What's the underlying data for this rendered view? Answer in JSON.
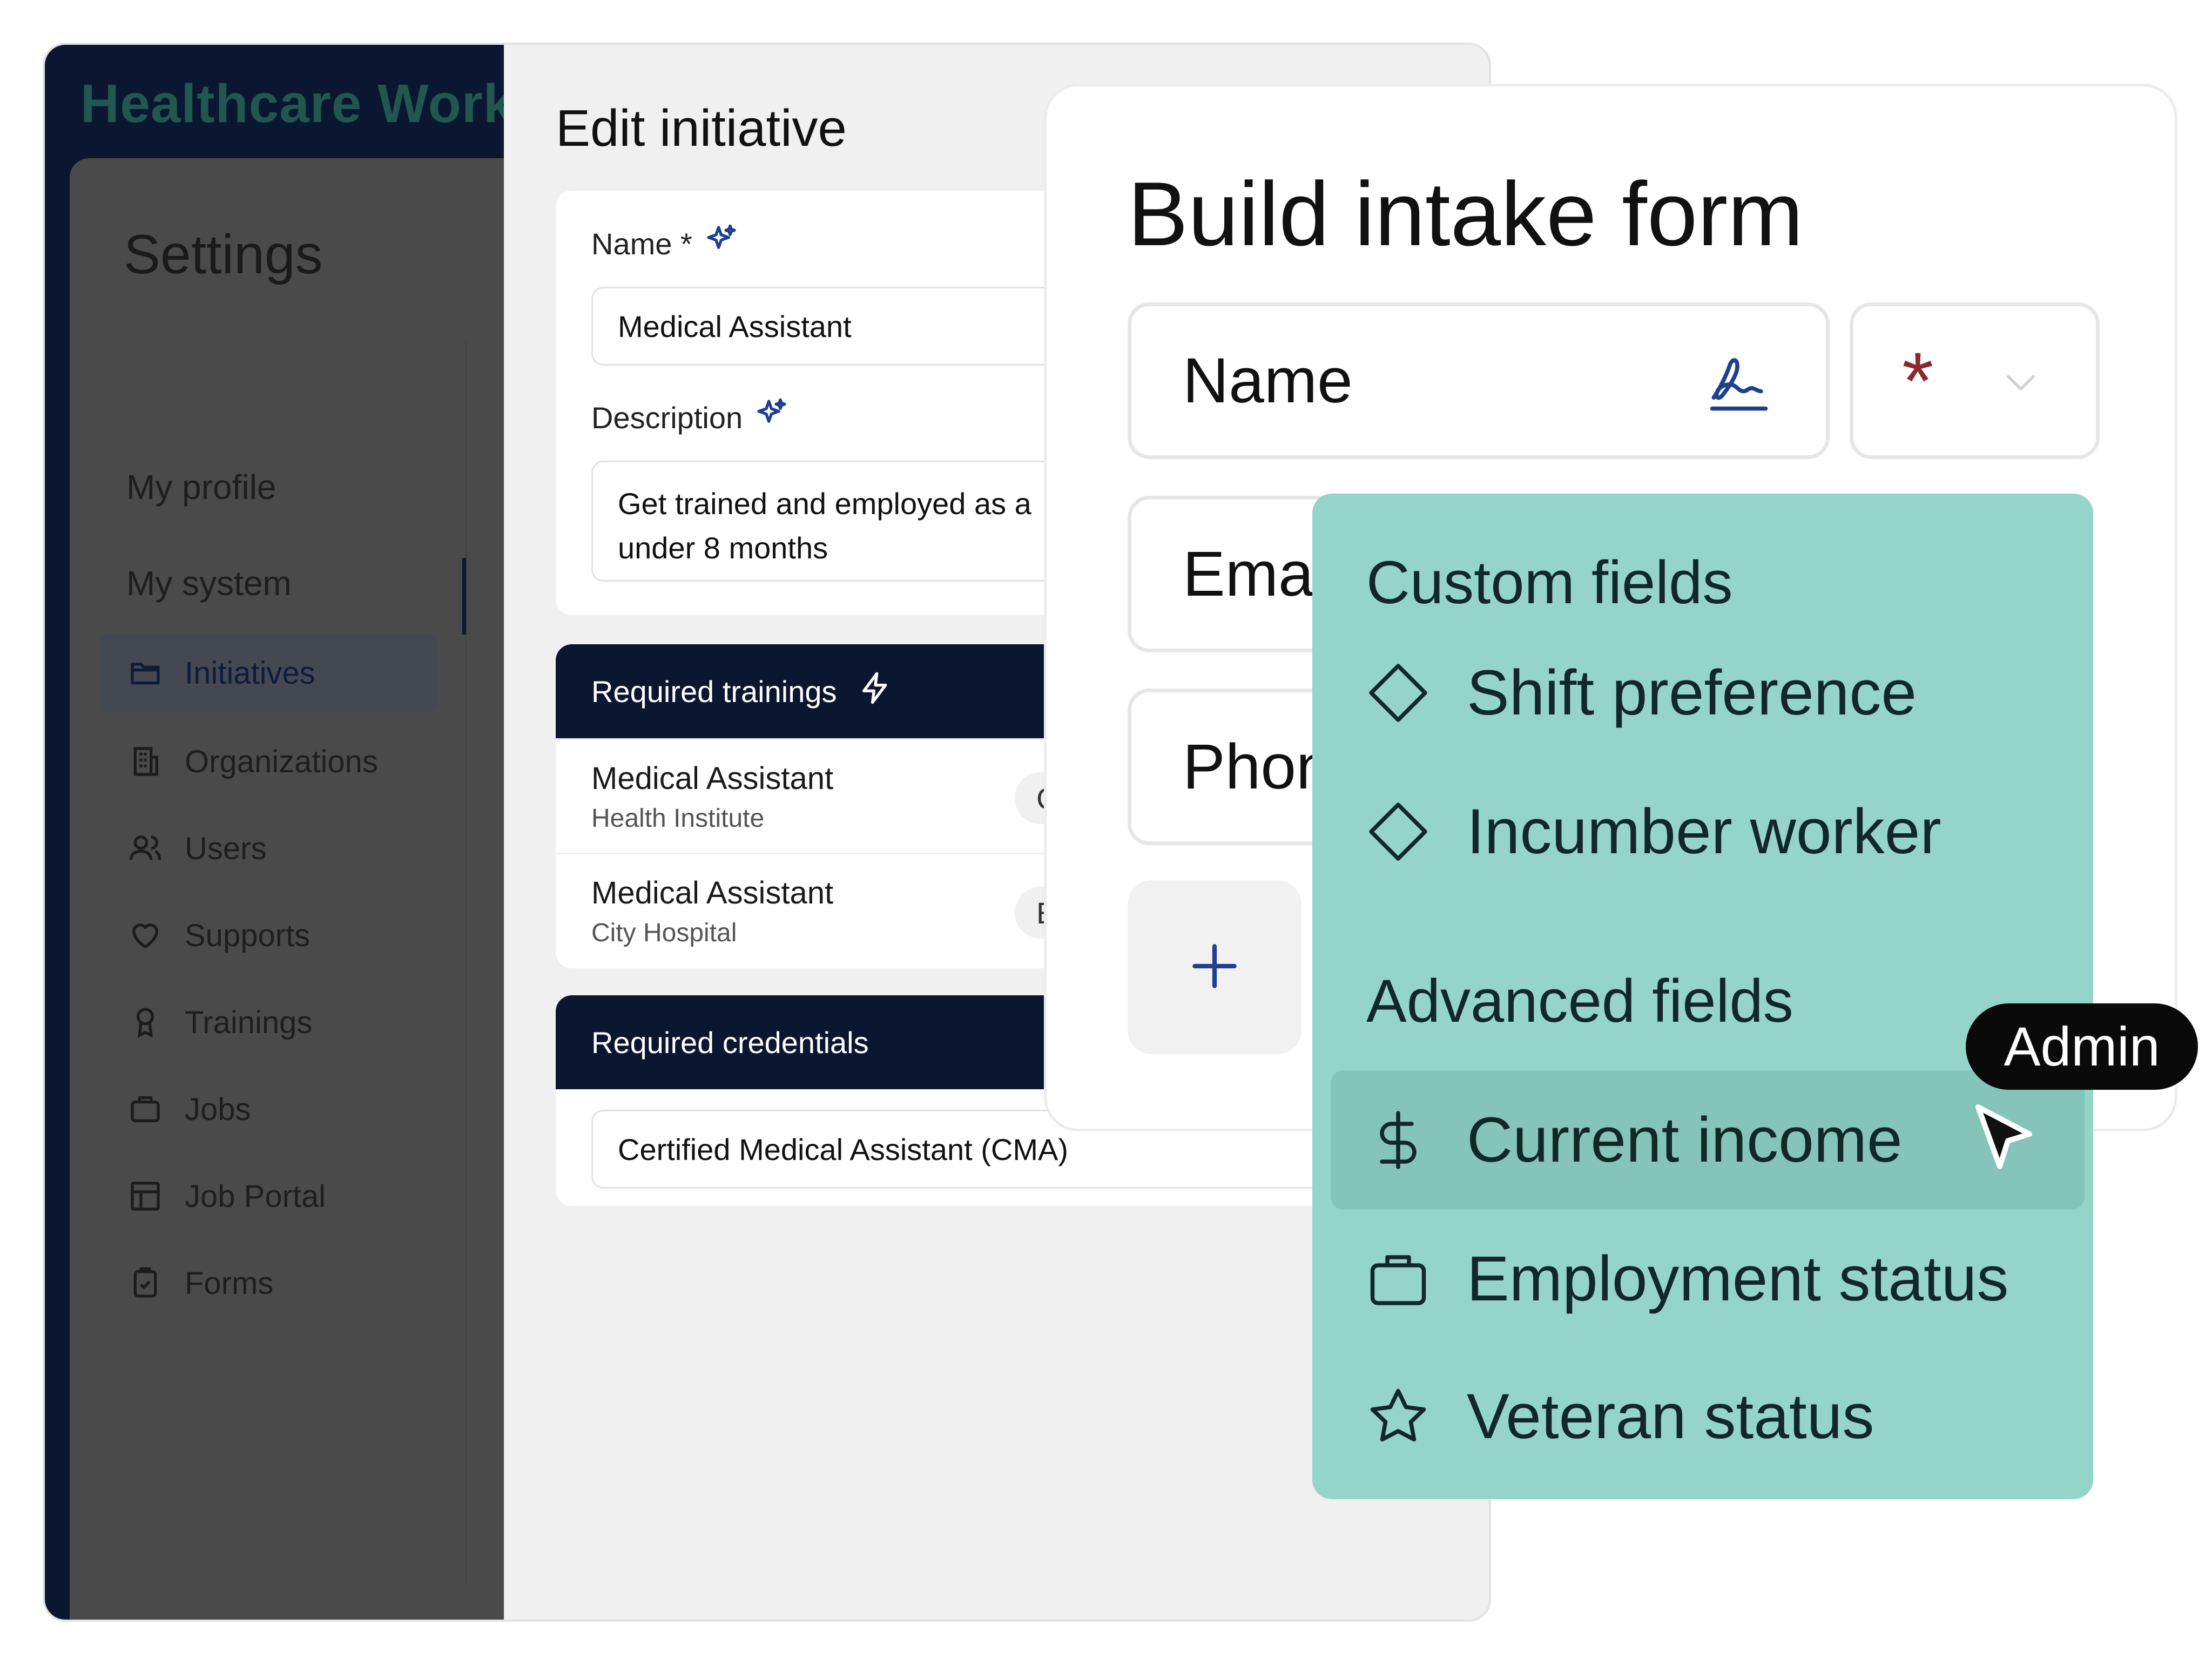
{
  "app": {
    "name": "Healthcare Work"
  },
  "settings": {
    "title": "Settings",
    "nav": [
      {
        "label": "My profile",
        "icon": "none"
      },
      {
        "label": "My system",
        "icon": "none"
      },
      {
        "label": "Initiatives",
        "icon": "folder-icon",
        "active": true
      },
      {
        "label": "Organizations",
        "icon": "building-icon"
      },
      {
        "label": "Users",
        "icon": "users-icon"
      },
      {
        "label": "Supports",
        "icon": "heart-icon"
      },
      {
        "label": "Trainings",
        "icon": "award-icon"
      },
      {
        "label": "Jobs",
        "icon": "briefcase-icon"
      },
      {
        "label": "Job Portal",
        "icon": "layout-icon"
      },
      {
        "label": "Forms",
        "icon": "clipboard-icon"
      }
    ]
  },
  "edit_initiative": {
    "title": "Edit initiative",
    "name_label": "Name *",
    "name_value": "Medical Assistant",
    "description_label": "Description",
    "description_line1": "Get trained and employed as a",
    "description_line2": "under 8 months",
    "trainings_header": "Required trainings",
    "trainings": [
      {
        "title": "Medical Assistant",
        "org": "Health Institute",
        "chip": "C"
      },
      {
        "title": "Medical Assistant",
        "org": "City Hospital",
        "chip": "E"
      }
    ],
    "credentials_header": "Required credentials",
    "credential_value": "Certified Medical Assistant (CMA)"
  },
  "intake_form": {
    "title": "Build intake form",
    "fields": [
      {
        "label": "Name"
      },
      {
        "label": "Emai"
      },
      {
        "label": "Phon"
      }
    ],
    "required_marker": "*"
  },
  "fields_menu": {
    "custom_heading": "Custom fields",
    "custom_items": [
      {
        "label": "Shift preference",
        "icon": "diamond-icon"
      },
      {
        "label": "Incumber worker",
        "icon": "diamond-icon"
      }
    ],
    "advanced_heading": "Advanced fields",
    "advanced_items": [
      {
        "label": "Current income",
        "icon": "dollar-icon",
        "hovered": true
      },
      {
        "label": "Employment status",
        "icon": "briefcase-icon"
      },
      {
        "label": "Veteran status",
        "icon": "star-icon"
      }
    ]
  },
  "admin_badge": "Admin",
  "colors": {
    "navy": "#0b1731",
    "teal_menu": "#95d5c8",
    "required_red": "#8a2a2e",
    "accent_blue": "#1f3f8f"
  }
}
